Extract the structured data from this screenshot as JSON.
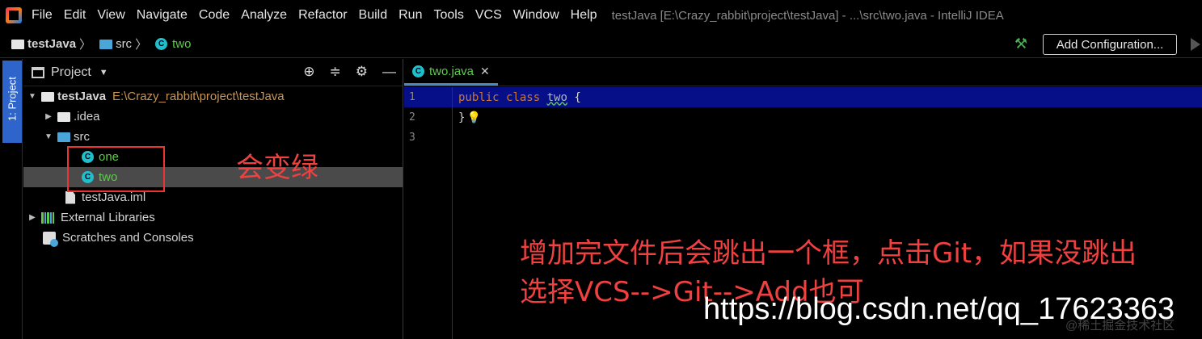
{
  "menubar": {
    "items": [
      "File",
      "Edit",
      "View",
      "Navigate",
      "Code",
      "Analyze",
      "Refactor",
      "Build",
      "Run",
      "Tools",
      "VCS",
      "Window",
      "Help"
    ],
    "title": "testJava [E:\\Crazy_rabbit\\project\\testJava] - ...\\src\\two.java - IntelliJ IDEA"
  },
  "navbar": {
    "crumbs": [
      "testJava",
      "src",
      "two"
    ],
    "add_config": "Add Configuration..."
  },
  "toolstrip": {
    "project_tab": "1: Project"
  },
  "project_panel": {
    "title": "Project",
    "tree": {
      "root": "testJava",
      "root_path": "E:\\Crazy_rabbit\\project\\testJava",
      "idea": ".idea",
      "src": "src",
      "one": "one",
      "two": "two",
      "iml": "testJava.iml",
      "libs": "External Libraries",
      "scratches": "Scratches and Consoles"
    },
    "class_icon_letter": "C"
  },
  "editor": {
    "tab_label": "two.java",
    "line_numbers": [
      "1",
      "2",
      "3"
    ],
    "code": {
      "kw1": "public",
      "kw2": "class",
      "name": "two",
      "brace_open": "{",
      "brace_close": "}"
    }
  },
  "annotations": {
    "small": "会变绿",
    "line1": "增加完文件后会跳出一个框，点击Git，如果没跳出",
    "line2": "选择VCS-->Git-->Add也可",
    "watermark": "https://blog.csdn.net/qq_17623363",
    "watermark2": "@稀土掘金技术社区"
  },
  "colors": {
    "accent": "#2f65ca",
    "annotation": "#f04040",
    "vcs_added": "#5ecb4c",
    "highlight": "#060f87"
  }
}
